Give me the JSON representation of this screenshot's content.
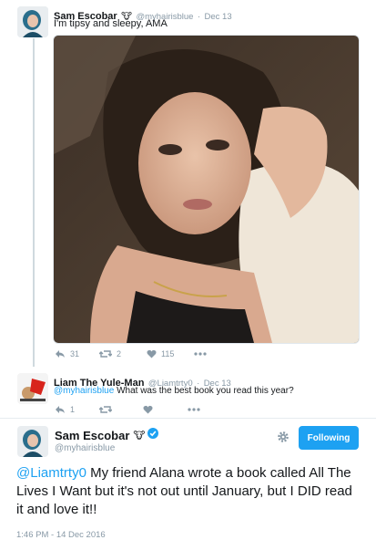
{
  "tweet1": {
    "author_name": "Sam Escobar",
    "author_handle": "@myhairisblue",
    "separator": "·",
    "date": "Dec 13",
    "text": "I'm tipsy and sleepy, AMA",
    "actions": {
      "replies": "31",
      "retweets": "2",
      "likes": "115"
    }
  },
  "tweet2": {
    "author_name": "Liam The Yule-Man",
    "author_handle": "@Liamtrty0",
    "separator": "·",
    "date": "Dec 13",
    "reply_mention": "@myhairisblue",
    "text": "What was the best book you read this year?",
    "actions": {
      "replies": "1",
      "retweets": "",
      "likes": ""
    }
  },
  "main_tweet": {
    "author_name": "Sam Escobar",
    "author_handle": "@myhairisblue",
    "follow_label": "Following",
    "mention": "@Liamtrty0",
    "text": "My friend Alana wrote a book called All The Lives I Want but it's not out until January, but I DID read it and love it!!",
    "timestamp": "1:46 PM - 14 Dec 2016"
  },
  "colors": {
    "accent": "#1da1f2",
    "meta": "#8899a6",
    "line": "#cfd9de",
    "photo_bg": "#4a3a2e"
  }
}
